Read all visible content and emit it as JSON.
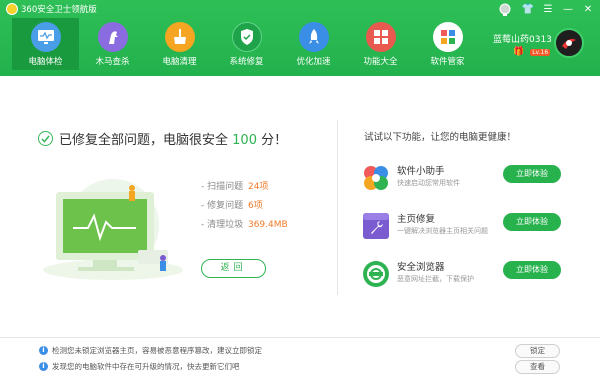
{
  "app": {
    "title": "360安全卫士领航版"
  },
  "nav": [
    {
      "label": "电脑体检",
      "icon": "monitor-check-icon"
    },
    {
      "label": "木马查杀",
      "icon": "horse-icon"
    },
    {
      "label": "电脑清理",
      "icon": "broom-icon"
    },
    {
      "label": "系统修复",
      "icon": "shield-icon"
    },
    {
      "label": "优化加速",
      "icon": "rocket-icon"
    },
    {
      "label": "功能大全",
      "icon": "grid-icon"
    },
    {
      "label": "软件管家",
      "icon": "software-manager-icon"
    }
  ],
  "user": {
    "name": "蓝莓山药0313",
    "level": "Lv.16"
  },
  "result": {
    "prefix": "已修复全部问题，电脑很安全",
    "score": "100",
    "suffix": "分！"
  },
  "stats": [
    {
      "label": "- 扫描问题",
      "value": "24项"
    },
    {
      "label": "- 修复问题",
      "value": "6项"
    },
    {
      "label": "- 清理垃圾",
      "value": "369.4MB"
    }
  ],
  "back_label": "返回",
  "recommend": {
    "title": "试试以下功能，让您的电脑更健康！",
    "items": [
      {
        "name": "软件小助手",
        "desc": "快速启动您常用软件",
        "button": "立即体验"
      },
      {
        "name": "主页修复",
        "desc": "一键解决浏览器主页相关问题",
        "button": "立即体验"
      },
      {
        "name": "安全浏览器",
        "desc": "恶意网址拦截，下载保护",
        "button": "立即体验"
      }
    ]
  },
  "notices": [
    {
      "text": "检测您未锁定浏览器主页，容易被恶意程序篡改，建议立即锁定",
      "button": "锁定"
    },
    {
      "text": "发现您的电脑软件中存在可升级的情况，快去更新它们吧",
      "button": "查看"
    }
  ],
  "colors": {
    "brand": "#22b14c",
    "score": "#2fb352",
    "stat": "#f07a2a"
  }
}
